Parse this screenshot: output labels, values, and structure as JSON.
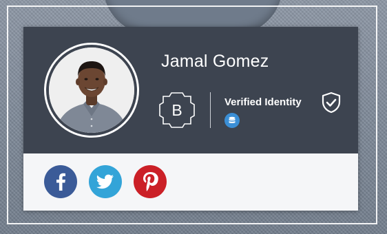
{
  "profile": {
    "name": "Jamal Gomez",
    "photo_alt": "profile-photo"
  },
  "identity": {
    "label": "Verified Identity",
    "logo_letter": "B",
    "icons": [
      "b-badge-icon",
      "shield-check-icon",
      "database-icon"
    ]
  },
  "social": {
    "items": [
      {
        "network": "facebook",
        "icon": "facebook-icon",
        "color": "#3b5b98"
      },
      {
        "network": "twitter",
        "icon": "twitter-icon",
        "color": "#33a4d8"
      },
      {
        "network": "pinterest",
        "icon": "pinterest-icon",
        "color": "#cb2027"
      }
    ]
  },
  "colors": {
    "card_header": "#3d4450",
    "card_footer": "#f5f6f8",
    "verified_badge": "#3b8fd6"
  }
}
